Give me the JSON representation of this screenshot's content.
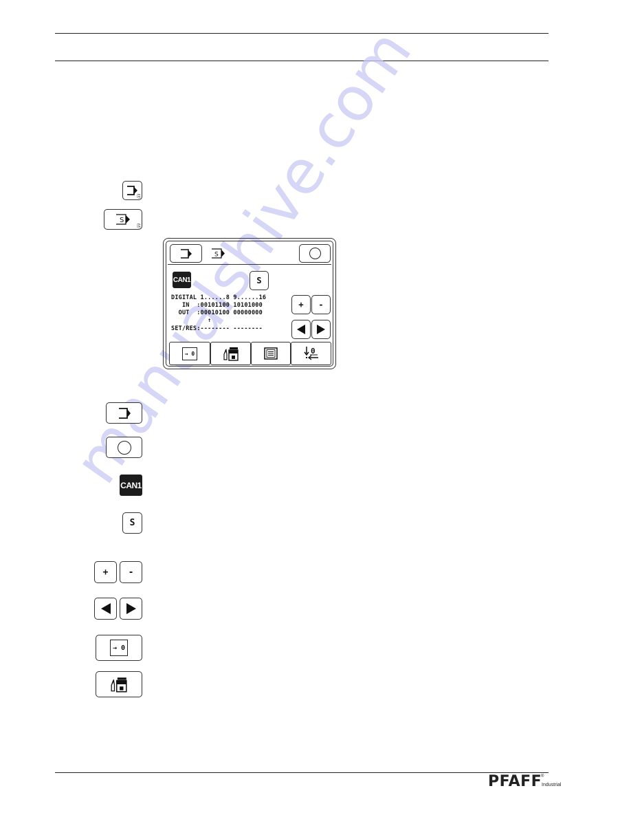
{
  "page": {
    "watermark": "manualshive.com",
    "footer": {
      "brand": "PFAFF",
      "brand_sub": "Industrial",
      "registered_mark": "®"
    }
  },
  "side_icons_top": [
    {
      "name": "input-mode-key",
      "icon": "bracket-arrow-icon"
    },
    {
      "name": "service-mode-key",
      "icon": "s-bracket-arrow-icon",
      "label": "S"
    }
  ],
  "screen": {
    "header": {
      "mode_button_icon": "bracket-arrow-icon",
      "service_tab_label": "S",
      "circle_button_icon": "circle-icon"
    },
    "can_badge": "CAN1",
    "s_button": "S",
    "io_table": {
      "header": "DIGITAL 1......8 9......16",
      "in_line": "   IN  :00101100 10101000",
      "out_line": "  OUT  :00010100 00000000",
      "cursor_line": "          ↑",
      "setres_line": "SET/RES:-------- --------"
    },
    "plus_label": "+",
    "minus_label": "-",
    "bottom_bar": [
      {
        "name": "reset-to-zero",
        "label": "→ 0",
        "icon": "arrow-zero-icon"
      },
      {
        "name": "machine-settings",
        "icon": "machine-memory-icon"
      },
      {
        "name": "list-view",
        "icon": "list-icon"
      },
      {
        "name": "zero-position",
        "label": "0",
        "icon": "down-arrow-zero-icon"
      }
    ]
  },
  "legend_icons": [
    {
      "name": "mode-key",
      "icon": "bracket-arrow-icon"
    },
    {
      "name": "circle-key",
      "icon": "circle-icon"
    },
    {
      "name": "can-badge",
      "label": "CAN1"
    },
    {
      "name": "s-key",
      "label": "S"
    },
    {
      "name": "plus-minus-keys",
      "labels": [
        "+",
        "-"
      ]
    },
    {
      "name": "arrow-keys",
      "icons": [
        "triangle-left-icon",
        "triangle-right-icon"
      ]
    },
    {
      "name": "reset-zero-key",
      "label": "→ 0"
    },
    {
      "name": "machine-settings-key",
      "icon": "machine-memory-icon"
    }
  ]
}
